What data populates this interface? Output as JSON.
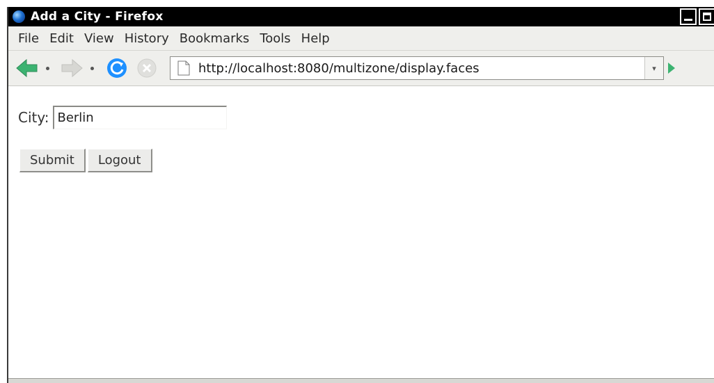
{
  "window": {
    "title": "Add a City - Firefox"
  },
  "menubar": {
    "items": [
      {
        "label": "File"
      },
      {
        "label": "Edit"
      },
      {
        "label": "View"
      },
      {
        "label": "History"
      },
      {
        "label": "Bookmarks"
      },
      {
        "label": "Tools"
      },
      {
        "label": "Help"
      }
    ]
  },
  "navbar": {
    "url": "http://localhost:8080/multizone/display.faces",
    "icons": [
      "back-icon",
      "forward-icon",
      "reload-icon",
      "stop-icon",
      "page-icon",
      "go-icon"
    ]
  },
  "form": {
    "city_label": "City:",
    "city_value": "Berlin",
    "submit_label": "Submit",
    "logout_label": "Logout"
  },
  "colors": {
    "titlebar": "#000000",
    "chrome": "#efefec",
    "back_arrow": "#3cb371",
    "reload": "#1e90ff"
  }
}
